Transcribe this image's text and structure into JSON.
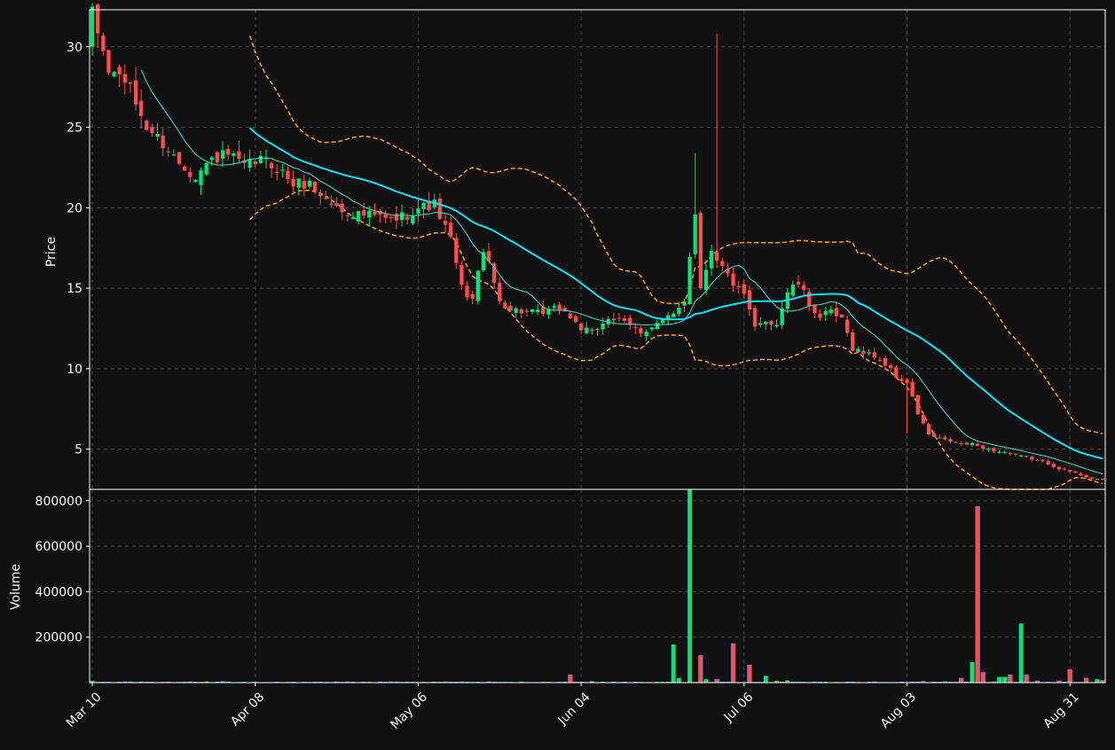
{
  "colors": {
    "background": "#111111",
    "grid": "#444444",
    "axis_text": "#ffffff",
    "frame": "#ffffff",
    "up": "#00e676",
    "down": "#ff4d4d",
    "ma_fast": "#40e0d0",
    "ma_slow": "#00e5ff",
    "bollinger": "#ffa500"
  },
  "chart_data": [
    {
      "type": "candlestick",
      "title": "",
      "ylabel": "Price",
      "ylim": [
        2.5,
        32.3
      ],
      "yticks": [
        5,
        10,
        15,
        20,
        25,
        30
      ],
      "grid": true,
      "xlim": [
        -0.5,
        186.5
      ],
      "xticks": [
        {
          "index": 0,
          "label": "Mar 10"
        },
        {
          "index": 30,
          "label": "Apr 08"
        },
        {
          "index": 60,
          "label": "May 06"
        },
        {
          "index": 90,
          "label": "Jun 04"
        },
        {
          "index": 120,
          "label": "Jul 06"
        },
        {
          "index": 150,
          "label": "Aug 03"
        },
        {
          "index": 180,
          "label": "Aug 31"
        }
      ],
      "anchors": {
        "close": [
          [
            0,
            32
          ],
          [
            3,
            28.5
          ],
          [
            6,
            28
          ],
          [
            10,
            25
          ],
          [
            13,
            24
          ],
          [
            16,
            22.8
          ],
          [
            19,
            22
          ],
          [
            22,
            23
          ],
          [
            25,
            23.3
          ],
          [
            28,
            22.5
          ],
          [
            31,
            23
          ],
          [
            34,
            22.5
          ],
          [
            37,
            21.5
          ],
          [
            40,
            21.5
          ],
          [
            43,
            20.5
          ],
          [
            46,
            19.8
          ],
          [
            49,
            19.6
          ],
          [
            52,
            19.5
          ],
          [
            55,
            19.2
          ],
          [
            58,
            19.6
          ],
          [
            60,
            20
          ],
          [
            63,
            20.2
          ],
          [
            66,
            18
          ],
          [
            68,
            15
          ],
          [
            70,
            14.3
          ],
          [
            72,
            17.5
          ],
          [
            75,
            14.2
          ],
          [
            77,
            13.7
          ],
          [
            80,
            13.5
          ],
          [
            83,
            13.4
          ],
          [
            86,
            13.8
          ],
          [
            88,
            13.2
          ],
          [
            90,
            12.5
          ],
          [
            92,
            12.2
          ],
          [
            95,
            13.2
          ],
          [
            98,
            12.8
          ],
          [
            101,
            12.3
          ],
          [
            104,
            12.8
          ],
          [
            107,
            13.3
          ],
          [
            109,
            14.3
          ],
          [
            111,
            19.8
          ],
          [
            112,
            15
          ],
          [
            114,
            17.5
          ],
          [
            116,
            16.3
          ],
          [
            118,
            15.3
          ],
          [
            120,
            14.5
          ],
          [
            122,
            12.5
          ],
          [
            124,
            13
          ],
          [
            126,
            12.8
          ],
          [
            128,
            14.8
          ],
          [
            130,
            15.3
          ],
          [
            132,
            14
          ],
          [
            134,
            13.2
          ],
          [
            136,
            13.5
          ],
          [
            138,
            13
          ],
          [
            140,
            11.3
          ],
          [
            142,
            11
          ],
          [
            144,
            10.8
          ],
          [
            146,
            10.3
          ],
          [
            148,
            9.5
          ],
          [
            150,
            9.1
          ],
          [
            152,
            7.2
          ],
          [
            154,
            5.9
          ],
          [
            156,
            5.6
          ],
          [
            158,
            5.5
          ],
          [
            160,
            5.3
          ],
          [
            162,
            5.3
          ],
          [
            164,
            5.1
          ],
          [
            166,
            4.9
          ],
          [
            168,
            4.8
          ],
          [
            170,
            4.6
          ],
          [
            172,
            4.5
          ],
          [
            174,
            4.3
          ],
          [
            176,
            4.1
          ],
          [
            178,
            3.8
          ],
          [
            180,
            3.6
          ],
          [
            182,
            3.4
          ],
          [
            184,
            3.2
          ],
          [
            186,
            3.1
          ]
        ]
      },
      "overlays": [
        {
          "kind": "sma",
          "period": 10,
          "color_key": "ma_fast"
        },
        {
          "kind": "sma",
          "period": 30,
          "color_key": "ma_slow"
        },
        {
          "kind": "bollinger",
          "period": 30,
          "std": 2,
          "color_key": "bollinger"
        }
      ]
    },
    {
      "type": "bar",
      "title": "",
      "ylabel": "Volume",
      "ylim": [
        0,
        850000
      ],
      "yticks": [
        200000,
        400000,
        600000,
        800000
      ],
      "ytick_labels": [
        "200000",
        "400000",
        "600000",
        "800000"
      ],
      "grid": true,
      "baseline_volume": 3000,
      "spikes": [
        [
          0,
          8000
        ],
        [
          6,
          4000
        ],
        [
          18,
          4000
        ],
        [
          21,
          5000
        ],
        [
          24,
          6000
        ],
        [
          69,
          3000
        ],
        [
          73,
          4000
        ],
        [
          88,
          35000
        ],
        [
          92,
          6000
        ],
        [
          107,
          168000
        ],
        [
          108,
          20000
        ],
        [
          110,
          848000
        ],
        [
          112,
          120000
        ],
        [
          113,
          15000
        ],
        [
          115,
          15000
        ],
        [
          118,
          172000
        ],
        [
          121,
          78000
        ],
        [
          124,
          30000
        ],
        [
          126,
          8000
        ],
        [
          128,
          10000
        ],
        [
          153,
          6000
        ],
        [
          157,
          5000
        ],
        [
          160,
          20000
        ],
        [
          162,
          90000
        ],
        [
          163,
          775000
        ],
        [
          164,
          45000
        ],
        [
          167,
          25000
        ],
        [
          168,
          25000
        ],
        [
          169,
          35000
        ],
        [
          171,
          260000
        ],
        [
          172,
          35000
        ],
        [
          174,
          8000
        ],
        [
          178,
          8000
        ],
        [
          180,
          58000
        ],
        [
          183,
          20000
        ],
        [
          185,
          15000
        ],
        [
          186,
          10000
        ],
        [
          190,
          8000
        ],
        [
          198,
          5000
        ],
        [
          200,
          45000
        ],
        [
          201,
          20000
        ]
      ]
    }
  ]
}
